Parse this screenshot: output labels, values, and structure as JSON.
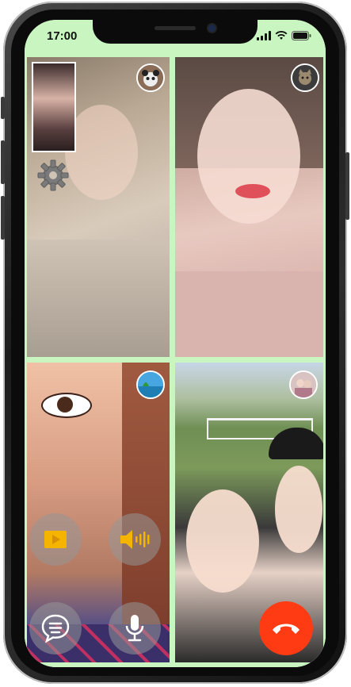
{
  "status_bar": {
    "time": "17:00",
    "icons": [
      "signal-icon",
      "wifi-icon",
      "battery-icon"
    ]
  },
  "colors": {
    "accent_green": "#c9f5c0",
    "end_call_red": "#ff3b13",
    "control_gray": "rgba(150,150,150,0.55)",
    "video_icon_yellow": "#f5b400"
  },
  "participants": [
    {
      "avatar": "panda-avatar",
      "self_view": true,
      "has_settings": true
    },
    {
      "avatar": "cat-avatar"
    },
    {
      "avatar": "beach-avatar"
    },
    {
      "avatar": "friends-avatar"
    }
  ],
  "controls": [
    {
      "name": "share-video-button",
      "icon": "video-play-icon"
    },
    {
      "name": "speaker-button",
      "icon": "speaker-volume-icon"
    },
    {
      "name": "chat-button",
      "icon": "chat-bubble-icon"
    },
    {
      "name": "microphone-button",
      "icon": "microphone-icon"
    },
    {
      "name": "end-call-button",
      "icon": "phone-hangup-icon"
    }
  ]
}
